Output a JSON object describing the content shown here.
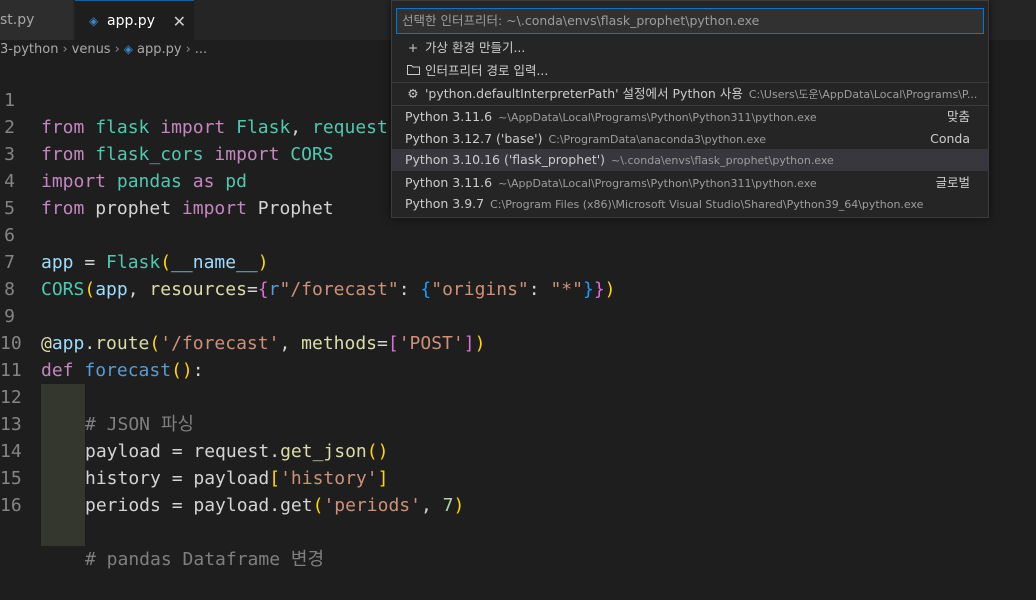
{
  "tabs": [
    {
      "label": "st.py"
    },
    {
      "label": "app.py",
      "close": "✕"
    }
  ],
  "breadcrumb": [
    "3-python",
    "venus",
    "app.py",
    "..."
  ],
  "editor": {
    "lines": [
      {
        "n": "1"
      },
      {
        "n": "2"
      },
      {
        "n": "3"
      },
      {
        "n": "4"
      },
      {
        "n": "5"
      },
      {
        "n": "6"
      },
      {
        "n": "7"
      },
      {
        "n": "8"
      },
      {
        "n": "9"
      },
      {
        "n": "10"
      },
      {
        "n": "11"
      },
      {
        "n": "12"
      },
      {
        "n": "13"
      },
      {
        "n": "14"
      },
      {
        "n": "15"
      },
      {
        "n": "16"
      }
    ],
    "code": {
      "l1": [
        "from",
        " ",
        "flask",
        " ",
        "import",
        " ",
        "Flask",
        ", ",
        "request"
      ],
      "l2": [
        "from",
        " ",
        "flask_cors",
        " ",
        "import",
        " ",
        "CORS"
      ],
      "l3": [
        "import",
        " ",
        "pandas",
        " ",
        "as",
        " ",
        "pd"
      ],
      "l4": [
        "from",
        " ",
        "prophet",
        " ",
        "import",
        " ",
        "Prophet"
      ],
      "l6": [
        "app",
        " = ",
        "Flask",
        "(",
        "__name__",
        ")"
      ],
      "l7": [
        "CORS",
        "(",
        "app",
        ", ",
        "resources",
        "=",
        "{",
        "r",
        "\"/forecast\"",
        ": ",
        "{",
        "\"origins\"",
        ": ",
        "\"*\"",
        "}",
        "}",
        ")"
      ],
      "l9": [
        "@",
        "app",
        ".",
        "route",
        "(",
        "'/forecast'",
        ", ",
        "methods",
        "=",
        "[",
        "'POST'",
        "]",
        ")"
      ],
      "l10": [
        "def",
        " ",
        "forecast",
        "(",
        ")",
        ":"
      ],
      "l11": [
        "# JSON 파싱"
      ],
      "l12": [
        "payload",
        " = ",
        "request",
        ".",
        "get_json",
        "(",
        ")"
      ],
      "l13": [
        "history",
        " = ",
        "payload",
        "[",
        "'history'",
        "]"
      ],
      "l14": [
        "periods",
        " = ",
        "payload",
        ".",
        "get",
        "(",
        "'periods'",
        ", ",
        "7",
        ")"
      ],
      "l16": [
        "# pandas Dataframe 변경"
      ]
    }
  },
  "quickpick": {
    "placeholder": "선택한 인터프리터: ~\\.conda\\envs\\flask_prophet\\python.exe",
    "actions": [
      {
        "icon": "+",
        "label": "가상 환경 만들기..."
      },
      {
        "icon": "folder",
        "label": "인터프리터 경로 입력..."
      },
      {
        "icon": "gear",
        "label": "'python.defaultInterpreterPath' 설정에서 Python 사용",
        "desc": "C:\\Users\\도운\\AppData\\Local\\Programs\\P..."
      }
    ],
    "interpreters": [
      {
        "label": "Python 3.11.6",
        "desc": "~\\AppData\\Local\\Programs\\Python\\Python311\\python.exe",
        "right": "맞춤"
      },
      {
        "label": "Python 3.12.7 ('base')",
        "desc": "C:\\ProgramData\\anaconda3\\python.exe",
        "right": "Conda"
      },
      {
        "label": "Python 3.10.16 ('flask_prophet')",
        "desc": "~\\.conda\\envs\\flask_prophet\\python.exe",
        "right": "",
        "selected": true
      },
      {
        "label": "Python 3.11.6",
        "desc": "~\\AppData\\Local\\Programs\\Python\\Python311\\python.exe",
        "right": "글로벌"
      },
      {
        "label": "Python 3.9.7",
        "desc": "C:\\Program Files (x86)\\Microsoft Visual Studio\\Shared\\Python39_64\\python.exe",
        "right": ""
      }
    ]
  },
  "icons": {
    "python_file": "python-file-icon",
    "close": "close-icon",
    "plus": "plus-icon",
    "folder": "folder-icon",
    "gear": "gear-icon"
  },
  "colors": {
    "accent": "#0078d4",
    "selection": "#37373d"
  }
}
